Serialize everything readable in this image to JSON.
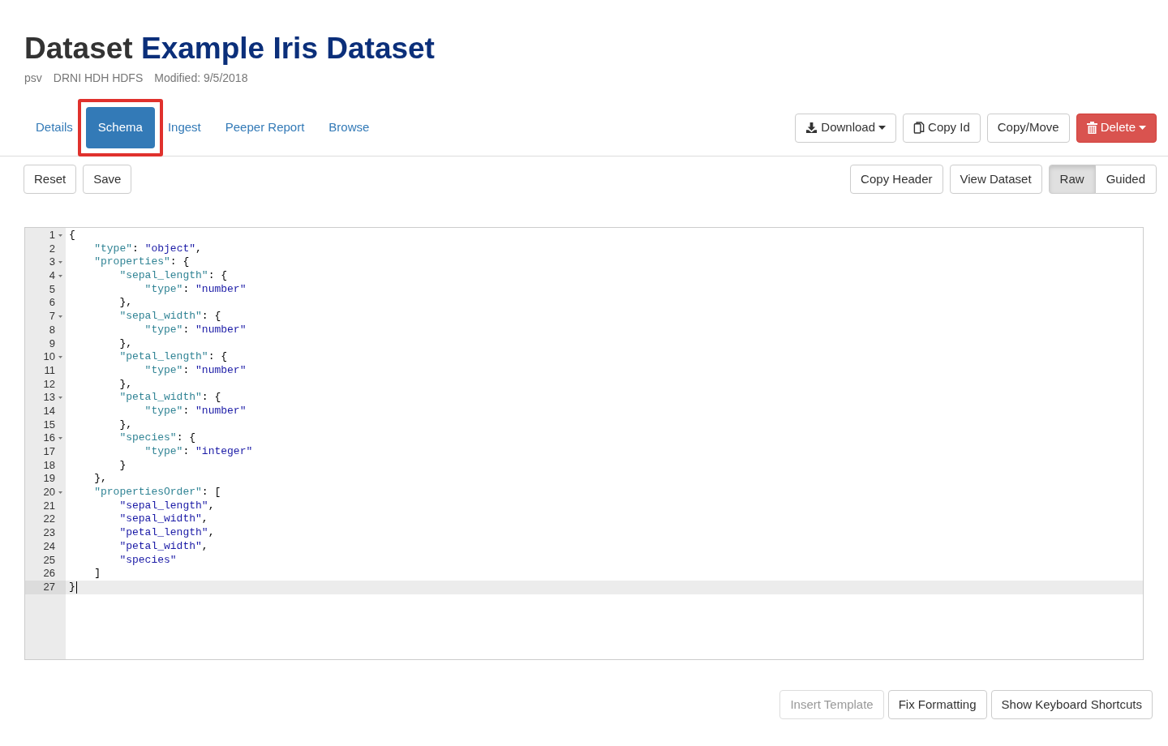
{
  "header": {
    "title_prefix": "Dataset",
    "title_name": "Example Iris Dataset",
    "meta": [
      "psv",
      "DRNI HDH HDFS",
      "Modified: 9/5/2018"
    ]
  },
  "tabs": [
    {
      "label": "Details",
      "selected": false,
      "highlighted": false
    },
    {
      "label": "Schema",
      "selected": true,
      "highlighted": true
    },
    {
      "label": "Ingest",
      "selected": false,
      "highlighted": false
    },
    {
      "label": "Peeper Report",
      "selected": false,
      "highlighted": false
    },
    {
      "label": "Browse",
      "selected": false,
      "highlighted": false
    }
  ],
  "actions": [
    {
      "label": "Download",
      "kind": "download",
      "dropdown": true
    },
    {
      "label": "Copy Id",
      "kind": "copy",
      "dropdown": false
    },
    {
      "label": "Copy/Move",
      "kind": "plain",
      "dropdown": false
    },
    {
      "label": "Delete",
      "kind": "trash",
      "dropdown": true
    }
  ],
  "editor_left_buttons": [
    "Reset",
    "Save"
  ],
  "editor_right_buttons": [
    "Copy Header",
    "View Dataset"
  ],
  "mode_toggle": [
    {
      "label": "Raw",
      "selected": true
    },
    {
      "label": "Guided",
      "selected": false
    }
  ],
  "editor": {
    "lines": [
      {
        "number": "1",
        "foldable": true,
        "active": false,
        "tokens": [
          {
            "kind": "punct",
            "text": "{"
          }
        ]
      },
      {
        "number": "2",
        "foldable": false,
        "active": false,
        "tokens": [
          {
            "kind": "key",
            "text": "    \"type\""
          },
          {
            "kind": "punct",
            "text": ": "
          },
          {
            "kind": "string",
            "text": "\"object\""
          },
          {
            "kind": "punct",
            "text": ","
          }
        ]
      },
      {
        "number": "3",
        "foldable": true,
        "active": false,
        "tokens": [
          {
            "kind": "key",
            "text": "    \"properties\""
          },
          {
            "kind": "punct",
            "text": ": {"
          }
        ]
      },
      {
        "number": "4",
        "foldable": true,
        "active": false,
        "tokens": [
          {
            "kind": "key",
            "text": "        \"sepal_length\""
          },
          {
            "kind": "punct",
            "text": ": {"
          }
        ]
      },
      {
        "number": "5",
        "foldable": false,
        "active": false,
        "tokens": [
          {
            "kind": "key",
            "text": "            \"type\""
          },
          {
            "kind": "punct",
            "text": ": "
          },
          {
            "kind": "string",
            "text": "\"number\""
          }
        ]
      },
      {
        "number": "6",
        "foldable": false,
        "active": false,
        "tokens": [
          {
            "kind": "punct",
            "text": "        },"
          }
        ]
      },
      {
        "number": "7",
        "foldable": true,
        "active": false,
        "tokens": [
          {
            "kind": "key",
            "text": "        \"sepal_width\""
          },
          {
            "kind": "punct",
            "text": ": {"
          }
        ]
      },
      {
        "number": "8",
        "foldable": false,
        "active": false,
        "tokens": [
          {
            "kind": "key",
            "text": "            \"type\""
          },
          {
            "kind": "punct",
            "text": ": "
          },
          {
            "kind": "string",
            "text": "\"number\""
          }
        ]
      },
      {
        "number": "9",
        "foldable": false,
        "active": false,
        "tokens": [
          {
            "kind": "punct",
            "text": "        },"
          }
        ]
      },
      {
        "number": "10",
        "foldable": true,
        "active": false,
        "tokens": [
          {
            "kind": "key",
            "text": "        \"petal_length\""
          },
          {
            "kind": "punct",
            "text": ": {"
          }
        ]
      },
      {
        "number": "11",
        "foldable": false,
        "active": false,
        "tokens": [
          {
            "kind": "key",
            "text": "            \"type\""
          },
          {
            "kind": "punct",
            "text": ": "
          },
          {
            "kind": "string",
            "text": "\"number\""
          }
        ]
      },
      {
        "number": "12",
        "foldable": false,
        "active": false,
        "tokens": [
          {
            "kind": "punct",
            "text": "        },"
          }
        ]
      },
      {
        "number": "13",
        "foldable": true,
        "active": false,
        "tokens": [
          {
            "kind": "key",
            "text": "        \"petal_width\""
          },
          {
            "kind": "punct",
            "text": ": {"
          }
        ]
      },
      {
        "number": "14",
        "foldable": false,
        "active": false,
        "tokens": [
          {
            "kind": "key",
            "text": "            \"type\""
          },
          {
            "kind": "punct",
            "text": ": "
          },
          {
            "kind": "string",
            "text": "\"number\""
          }
        ]
      },
      {
        "number": "15",
        "foldable": false,
        "active": false,
        "tokens": [
          {
            "kind": "punct",
            "text": "        },"
          }
        ]
      },
      {
        "number": "16",
        "foldable": true,
        "active": false,
        "tokens": [
          {
            "kind": "key",
            "text": "        \"species\""
          },
          {
            "kind": "punct",
            "text": ": {"
          }
        ]
      },
      {
        "number": "17",
        "foldable": false,
        "active": false,
        "tokens": [
          {
            "kind": "key",
            "text": "            \"type\""
          },
          {
            "kind": "punct",
            "text": ": "
          },
          {
            "kind": "string",
            "text": "\"integer\""
          }
        ]
      },
      {
        "number": "18",
        "foldable": false,
        "active": false,
        "tokens": [
          {
            "kind": "punct",
            "text": "        }"
          }
        ]
      },
      {
        "number": "19",
        "foldable": false,
        "active": false,
        "tokens": [
          {
            "kind": "punct",
            "text": "    },"
          }
        ]
      },
      {
        "number": "20",
        "foldable": true,
        "active": false,
        "tokens": [
          {
            "kind": "key",
            "text": "    \"propertiesOrder\""
          },
          {
            "kind": "punct",
            "text": ": ["
          }
        ]
      },
      {
        "number": "21",
        "foldable": false,
        "active": false,
        "tokens": [
          {
            "kind": "string",
            "text": "        \"sepal_length\""
          },
          {
            "kind": "punct",
            "text": ","
          }
        ]
      },
      {
        "number": "22",
        "foldable": false,
        "active": false,
        "tokens": [
          {
            "kind": "string",
            "text": "        \"sepal_width\""
          },
          {
            "kind": "punct",
            "text": ","
          }
        ]
      },
      {
        "number": "23",
        "foldable": false,
        "active": false,
        "tokens": [
          {
            "kind": "string",
            "text": "        \"petal_length\""
          },
          {
            "kind": "punct",
            "text": ","
          }
        ]
      },
      {
        "number": "24",
        "foldable": false,
        "active": false,
        "tokens": [
          {
            "kind": "string",
            "text": "        \"petal_width\""
          },
          {
            "kind": "punct",
            "text": ","
          }
        ]
      },
      {
        "number": "25",
        "foldable": false,
        "active": false,
        "tokens": [
          {
            "kind": "string",
            "text": "        \"species\""
          }
        ]
      },
      {
        "number": "26",
        "foldable": false,
        "active": false,
        "tokens": [
          {
            "kind": "punct",
            "text": "    ]"
          }
        ]
      },
      {
        "number": "27",
        "foldable": false,
        "active": true,
        "tokens": [
          {
            "kind": "punct",
            "text": "}"
          }
        ]
      }
    ]
  },
  "footer_buttons": [
    {
      "label": "Insert Template",
      "disabled": true
    },
    {
      "label": "Fix Formatting",
      "disabled": false
    },
    {
      "label": "Show Keyboard Shortcuts",
      "disabled": false
    }
  ]
}
